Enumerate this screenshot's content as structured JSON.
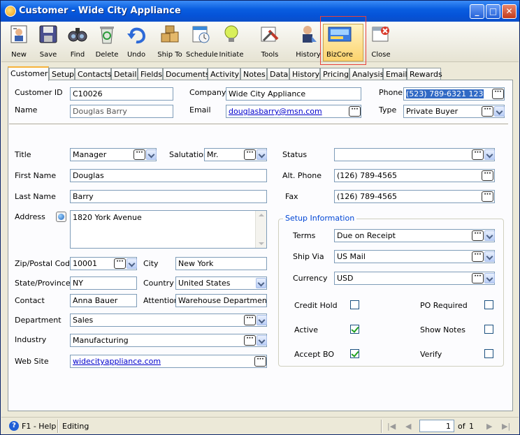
{
  "window": {
    "title": "Customer - Wide City Appliance",
    "controls": [
      "minimize-icon",
      "maximize-icon",
      "close-icon"
    ]
  },
  "toolbar": {
    "buttons": [
      {
        "label": "New",
        "icon": "new-customer-icon"
      },
      {
        "label": "Save",
        "icon": "floppy-disk-icon"
      },
      {
        "label": "Find",
        "icon": "binoculars-icon"
      },
      {
        "label": "Delete",
        "icon": "recycle-bin-icon"
      },
      {
        "label": "Undo",
        "icon": "undo-arrow-icon"
      },
      {
        "label": "Ship To",
        "icon": "boxes-icon"
      },
      {
        "label": "Schedule",
        "icon": "calendar-clock-icon"
      },
      {
        "label": "Initiate",
        "icon": "lightbulb-icon"
      },
      {
        "label": "Tools",
        "icon": "tools-icon"
      },
      {
        "label": "History",
        "icon": "person-history-icon"
      },
      {
        "label": "BizCore",
        "icon": "bizcore-icon"
      },
      {
        "label": "Close",
        "icon": "close-window-icon"
      }
    ]
  },
  "tabs": [
    "Customer",
    "Setup",
    "Contacts",
    "Detail",
    "Fields",
    "Documents",
    "Activity",
    "Notes",
    "Data",
    "History",
    "Pricing",
    "Analysis",
    "Email",
    "Rewards"
  ],
  "header": {
    "customer_id_label": "Customer ID",
    "customer_id": "C10026",
    "name_label": "Name",
    "name": "Douglas  Barry",
    "company_label": "Company",
    "company": "Wide City Appliance",
    "email_label": "Email",
    "email": "douglasbarry@msn.com",
    "phone_label": "Phone",
    "phone": "(523) 789-6321 123",
    "type_label": "Type",
    "type": "Private Buyer"
  },
  "form": {
    "title_label": "Title",
    "title": "Manager",
    "salutation_label": "Salutation",
    "salutation": "Mr.",
    "first_name_label": "First Name",
    "first_name": "Douglas",
    "last_name_label": "Last Name",
    "last_name": "Barry",
    "address_label": "Address",
    "address": "1820 York Avenue",
    "zip_label": "Zip/Postal Code",
    "zip": "10001",
    "city_label": "City",
    "city": "New York",
    "state_label": "State/Province",
    "state": "NY",
    "country_label": "Country",
    "country": "United States",
    "contact_label": "Contact",
    "contact": "Anna Bauer",
    "attention_label": "Attention",
    "attention": "Warehouse Department",
    "department_label": "Department",
    "department": "Sales",
    "industry_label": "Industry",
    "industry": "Manufacturing",
    "website_label": "Web Site",
    "website": "widecityappliance.com",
    "status_label": "Status",
    "status": "",
    "alt_phone_label": "Alt. Phone",
    "alt_phone": "(126) 789-4565",
    "fax_label": "Fax",
    "fax": "(126) 789-4565"
  },
  "setup": {
    "group_title": "Setup Information",
    "terms_label": "Terms",
    "terms": "Due on Receipt",
    "ship_via_label": "Ship Via",
    "ship_via": "US Mail",
    "currency_label": "Currency",
    "currency": "USD",
    "credit_hold_label": "Credit Hold",
    "credit_hold": false,
    "po_required_label": "PO Required",
    "po_required": false,
    "active_label": "Active",
    "active": true,
    "show_notes_label": "Show Notes",
    "show_notes": false,
    "accept_bo_label": "Accept BO",
    "accept_bo": true,
    "verify_label": "Verify",
    "verify": false
  },
  "statusbar": {
    "help": "F1 - Help",
    "mode": "Editing",
    "page": "1",
    "of_label": "of",
    "total": "1"
  },
  "colors": {
    "title_bar": "#0a5ee0",
    "highlight_frame": "#e8403a",
    "group_title": "#0046d5",
    "link": "#0000cc"
  }
}
